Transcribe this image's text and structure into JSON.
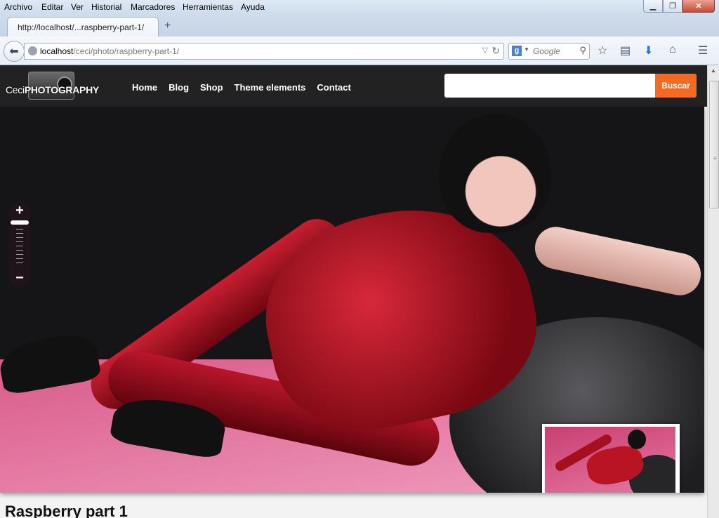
{
  "menubar": {
    "items": [
      "Archivo",
      "Editar",
      "Ver",
      "Historial",
      "Marcadores",
      "Herramientas",
      "Ayuda"
    ]
  },
  "window_controls": [
    "minimize-icon",
    "restore-icon",
    "close-icon"
  ],
  "tab": {
    "title": "http://localhost/...raspberry-part-1/",
    "new_tab_label": "+"
  },
  "address": {
    "host": "localhost",
    "path": "/ceci/photo/raspberry-part-1/"
  },
  "browser_search": {
    "placeholder": "Google"
  },
  "toolbar_icons": [
    "bookmark-star-icon",
    "reading-list-icon",
    "download-icon",
    "home-icon",
    "menu-icon"
  ],
  "site": {
    "logo": {
      "prefix": "Ceci",
      "main": "PHOTOGRAPHY"
    },
    "nav": [
      "Home",
      "Blog",
      "Shop",
      "Theme elements",
      "Contact"
    ],
    "search_value": "",
    "search_button": "Buscar",
    "accent_color": "#f26a24"
  },
  "gallery": {
    "zoom_in": "+",
    "zoom_out": "−",
    "zoom_level": 0
  },
  "post": {
    "title": "Raspberry part 1"
  }
}
